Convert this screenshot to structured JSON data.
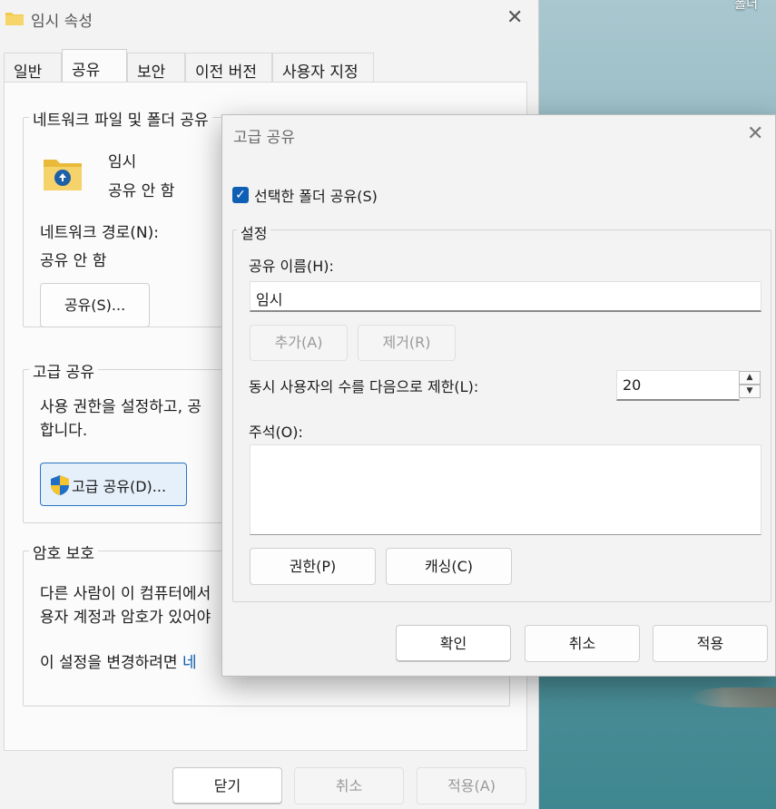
{
  "desktop": {
    "label": "폴더"
  },
  "props": {
    "title": "임시 속성",
    "tabs": [
      "일반",
      "공유",
      "보안",
      "이전 버전",
      "사용자 지정"
    ],
    "active_tab": "공유",
    "network_share": {
      "group_label": "네트워크 파일 및 폴더 공유",
      "folder_name": "임시",
      "share_status": "공유 안 함",
      "path_label": "네트워크 경로(N):",
      "path_value": "공유 안 함",
      "share_button": "공유(S)..."
    },
    "advanced": {
      "group_label": "고급 공유",
      "desc_line1": "사용 권한을 설정하고, 공",
      "desc_line2": "합니다.",
      "button": "고급 공유(D)..."
    },
    "password": {
      "group_label": "암호 보호",
      "desc_line1": "다른 사람이 이 컴퓨터에서",
      "desc_line2": "용자 계정과 암호가 있어야",
      "change_prefix": "이 설정을 변경하려면 ",
      "change_link": "네"
    },
    "footer": {
      "close": "닫기",
      "cancel": "취소",
      "apply": "적용(A)"
    }
  },
  "dialog": {
    "title": "고급 공유",
    "share_checkbox_label": "선택한 폴더 공유(S)",
    "share_checked": true,
    "settings": {
      "group_label": "설정",
      "share_name_label": "공유 이름(H):",
      "share_name_value": "임시",
      "add_button": "추가(A)",
      "remove_button": "제거(R)",
      "limit_label": "동시 사용자의 수를 다음으로 제한(L):",
      "limit_value": "20",
      "comment_label": "주석(O):",
      "permissions_button": "권한(P)",
      "caching_button": "캐싱(C)"
    },
    "buttons": {
      "ok": "확인",
      "cancel": "취소",
      "apply": "적용"
    }
  }
}
